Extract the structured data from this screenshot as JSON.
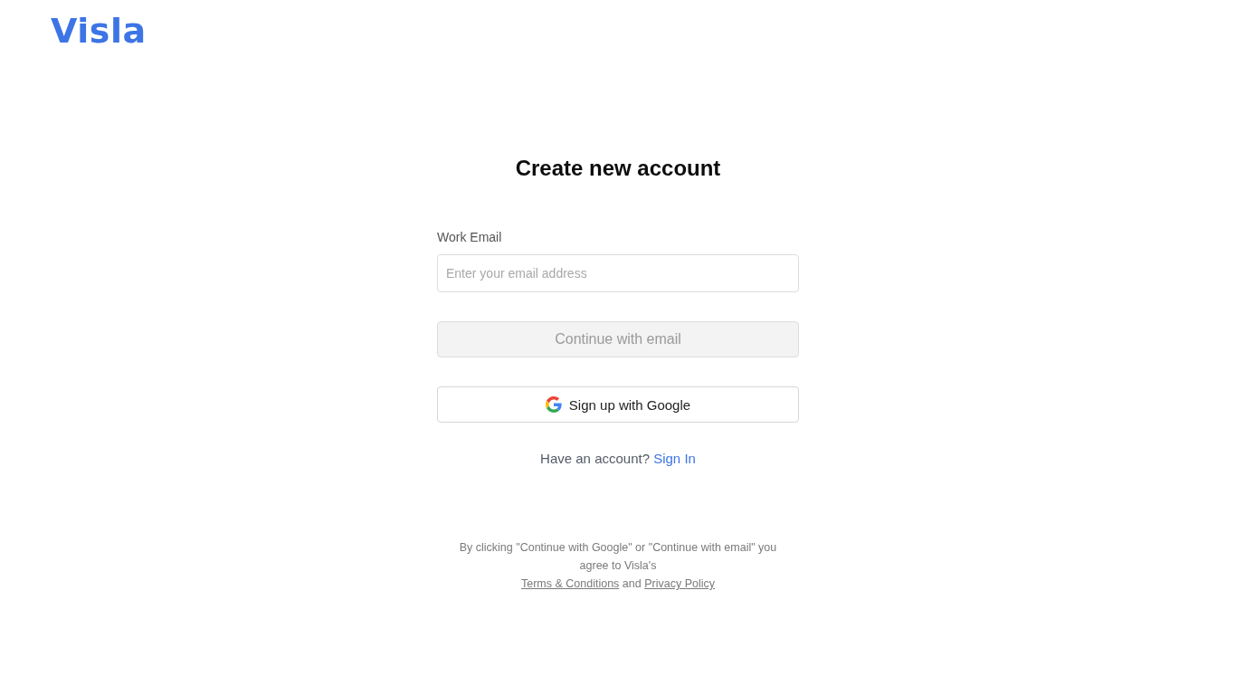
{
  "logo": {
    "text": "Visla"
  },
  "title": "Create new account",
  "email_field": {
    "label": "Work Email",
    "placeholder": "Enter your email address"
  },
  "buttons": [
    {
      "kind": "email",
      "label": "Continue with email",
      "disabled": true
    },
    {
      "kind": "google",
      "label": "Sign up with Google",
      "disabled": false
    }
  ],
  "signin_prompt": {
    "text": "Have an account?",
    "link": "Sign In"
  },
  "legal": {
    "text": "By clicking \"Continue with Google\" or \"Continue with email\" you agree to Visla's",
    "links": [
      "Terms & Conditions",
      "Privacy Policy"
    ],
    "joiner": "and"
  }
}
